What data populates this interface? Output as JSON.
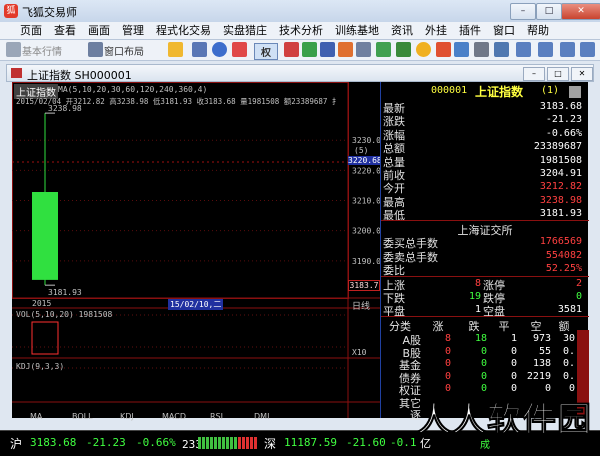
{
  "app": {
    "title": "飞狐交易师",
    "logo_text": "狐"
  },
  "window_controls": {
    "minimize": "–",
    "maximize": "□",
    "close": "✕"
  },
  "menu": [
    "页面",
    "查看",
    "画面",
    "管理",
    "程式化交易",
    "实盘猎庄",
    "技术分析",
    "训练基地",
    "资讯",
    "外挂",
    "插件",
    "窗口",
    "帮助"
  ],
  "toolbar": {
    "basic_quote": "基本行情",
    "window_layout": "窗口布局",
    "quan_label": "权"
  },
  "document": {
    "title": "上证指数 SH000001"
  },
  "chart": {
    "header_name": "上证指数",
    "ma_label": "MA(5,10,20,30,60,120,240,360,4)",
    "ohlc_line": "2015/02/04 开3212.82 高3238.98 低3181.93 收3183.68 量1981508 额23389687 扌",
    "bottom_date_left": "2015",
    "bottom_date_right": "15/02/10,二",
    "cursor_bubble": "(5)",
    "cursor_price": "3220.68",
    "close_marker": "3183.7",
    "period_label": "日线",
    "vol_label": "VOL(5,10,20) 1981508",
    "vol_scale": "X10",
    "kdj_label": "KDJ(9,3,3)",
    "candle_high_label": "3238.98",
    "candle_low_label": "3181.93",
    "indicator_tabs": [
      "MA",
      "BOLL",
      "KDJ",
      "MACD",
      "RSI",
      "DMI"
    ]
  },
  "chart_data": {
    "type": "candlestick",
    "y_ticks": [
      3230.0,
      3220.0,
      3210.0,
      3200.0,
      3190.0
    ],
    "y_tick_labels": [
      "3230.00",
      "3220.00",
      "3210.00",
      "3200.00",
      "3190.00"
    ],
    "ylim": [
      3179.0,
      3242.0
    ],
    "candles": [
      {
        "date": "2015/02/04",
        "open": 3212.82,
        "high": 3238.98,
        "low": 3181.93,
        "close": 3183.68
      }
    ],
    "volume": [
      1981508
    ]
  },
  "quote": {
    "code": "000001",
    "name": "上证指数",
    "badge": "(1)",
    "rows": [
      {
        "label": "最新",
        "value": "3183.68",
        "color": "#ffffff"
      },
      {
        "label": "涨跌",
        "value": "-21.23",
        "color": "#ffffff"
      },
      {
        "label": "涨幅",
        "value": "-0.66%",
        "color": "#ffffff"
      },
      {
        "label": "总额",
        "value": "23389687",
        "color": "#ffffff"
      },
      {
        "label": "总量",
        "value": "1981508",
        "color": "#ffffff"
      },
      {
        "label": "前收",
        "value": "3204.91",
        "color": "#ffffff"
      },
      {
        "label": "今开",
        "value": "3212.82",
        "color": "#ff4040"
      },
      {
        "label": "最高",
        "value": "3238.98",
        "color": "#ff4040"
      },
      {
        "label": "最低",
        "value": "3181.93",
        "color": "#ffffff"
      }
    ],
    "exchange": "上海证交所",
    "orders": [
      {
        "label": "委买总手数",
        "value": "1766569",
        "color": "#ff4040"
      },
      {
        "label": "委卖总手数",
        "value": "554082",
        "color": "#ff4040"
      },
      {
        "label": "委比",
        "value": "52.25%",
        "color": "#ff4040"
      }
    ],
    "breadth": [
      {
        "l1": "上涨",
        "v1": "8",
        "c1": "#ff4040",
        "l2": "涨停",
        "v2": "2",
        "c2": "#ff4040"
      },
      {
        "l1": "下跌",
        "v1": "19",
        "c1": "#40ff40",
        "l2": "跌停",
        "v2": "0",
        "c2": "#40ff40"
      },
      {
        "l1": "平盘",
        "v1": "1",
        "c1": "#ffffff",
        "l2": "空盘",
        "v2": "3581",
        "c2": "#ffffff"
      }
    ],
    "category_headers": [
      "分类",
      "涨",
      "跌",
      "平",
      "空",
      "额"
    ],
    "categories": [
      {
        "name": "A股",
        "up": "8",
        "down": "18",
        "flat": "1",
        "empty": "973",
        "amt": "30"
      },
      {
        "name": "B股",
        "up": "0",
        "down": "0",
        "flat": "0",
        "empty": "55",
        "amt": "0."
      },
      {
        "name": "基金",
        "up": "0",
        "down": "0",
        "flat": "0",
        "empty": "138",
        "amt": "0."
      },
      {
        "name": "债券",
        "up": "0",
        "down": "0",
        "flat": "0",
        "empty": "2219",
        "amt": "0."
      },
      {
        "name": "权证",
        "up": "0",
        "down": "0",
        "flat": "0",
        "empty": "0",
        "amt": "0"
      },
      {
        "name": "其它",
        "up": "",
        "down": "",
        "flat": "",
        "empty": "",
        "amt": ""
      },
      {
        "name": "逐",
        "up": "",
        "down": "",
        "flat": "",
        "empty": "",
        "amt": ""
      }
    ]
  },
  "status": {
    "sh_label": "沪",
    "sh_value": "3183.68",
    "sh_change": "-21.23",
    "sh_pct": "-0.66%",
    "sh_amount": "2338.97亿",
    "sz_label": "深",
    "sz_value": "11187.59",
    "sz_change": "-21.60",
    "sz_pct": "-0.1",
    "sz_amount": "亿",
    "right_text": "成"
  },
  "watermark": "人人软件园"
}
